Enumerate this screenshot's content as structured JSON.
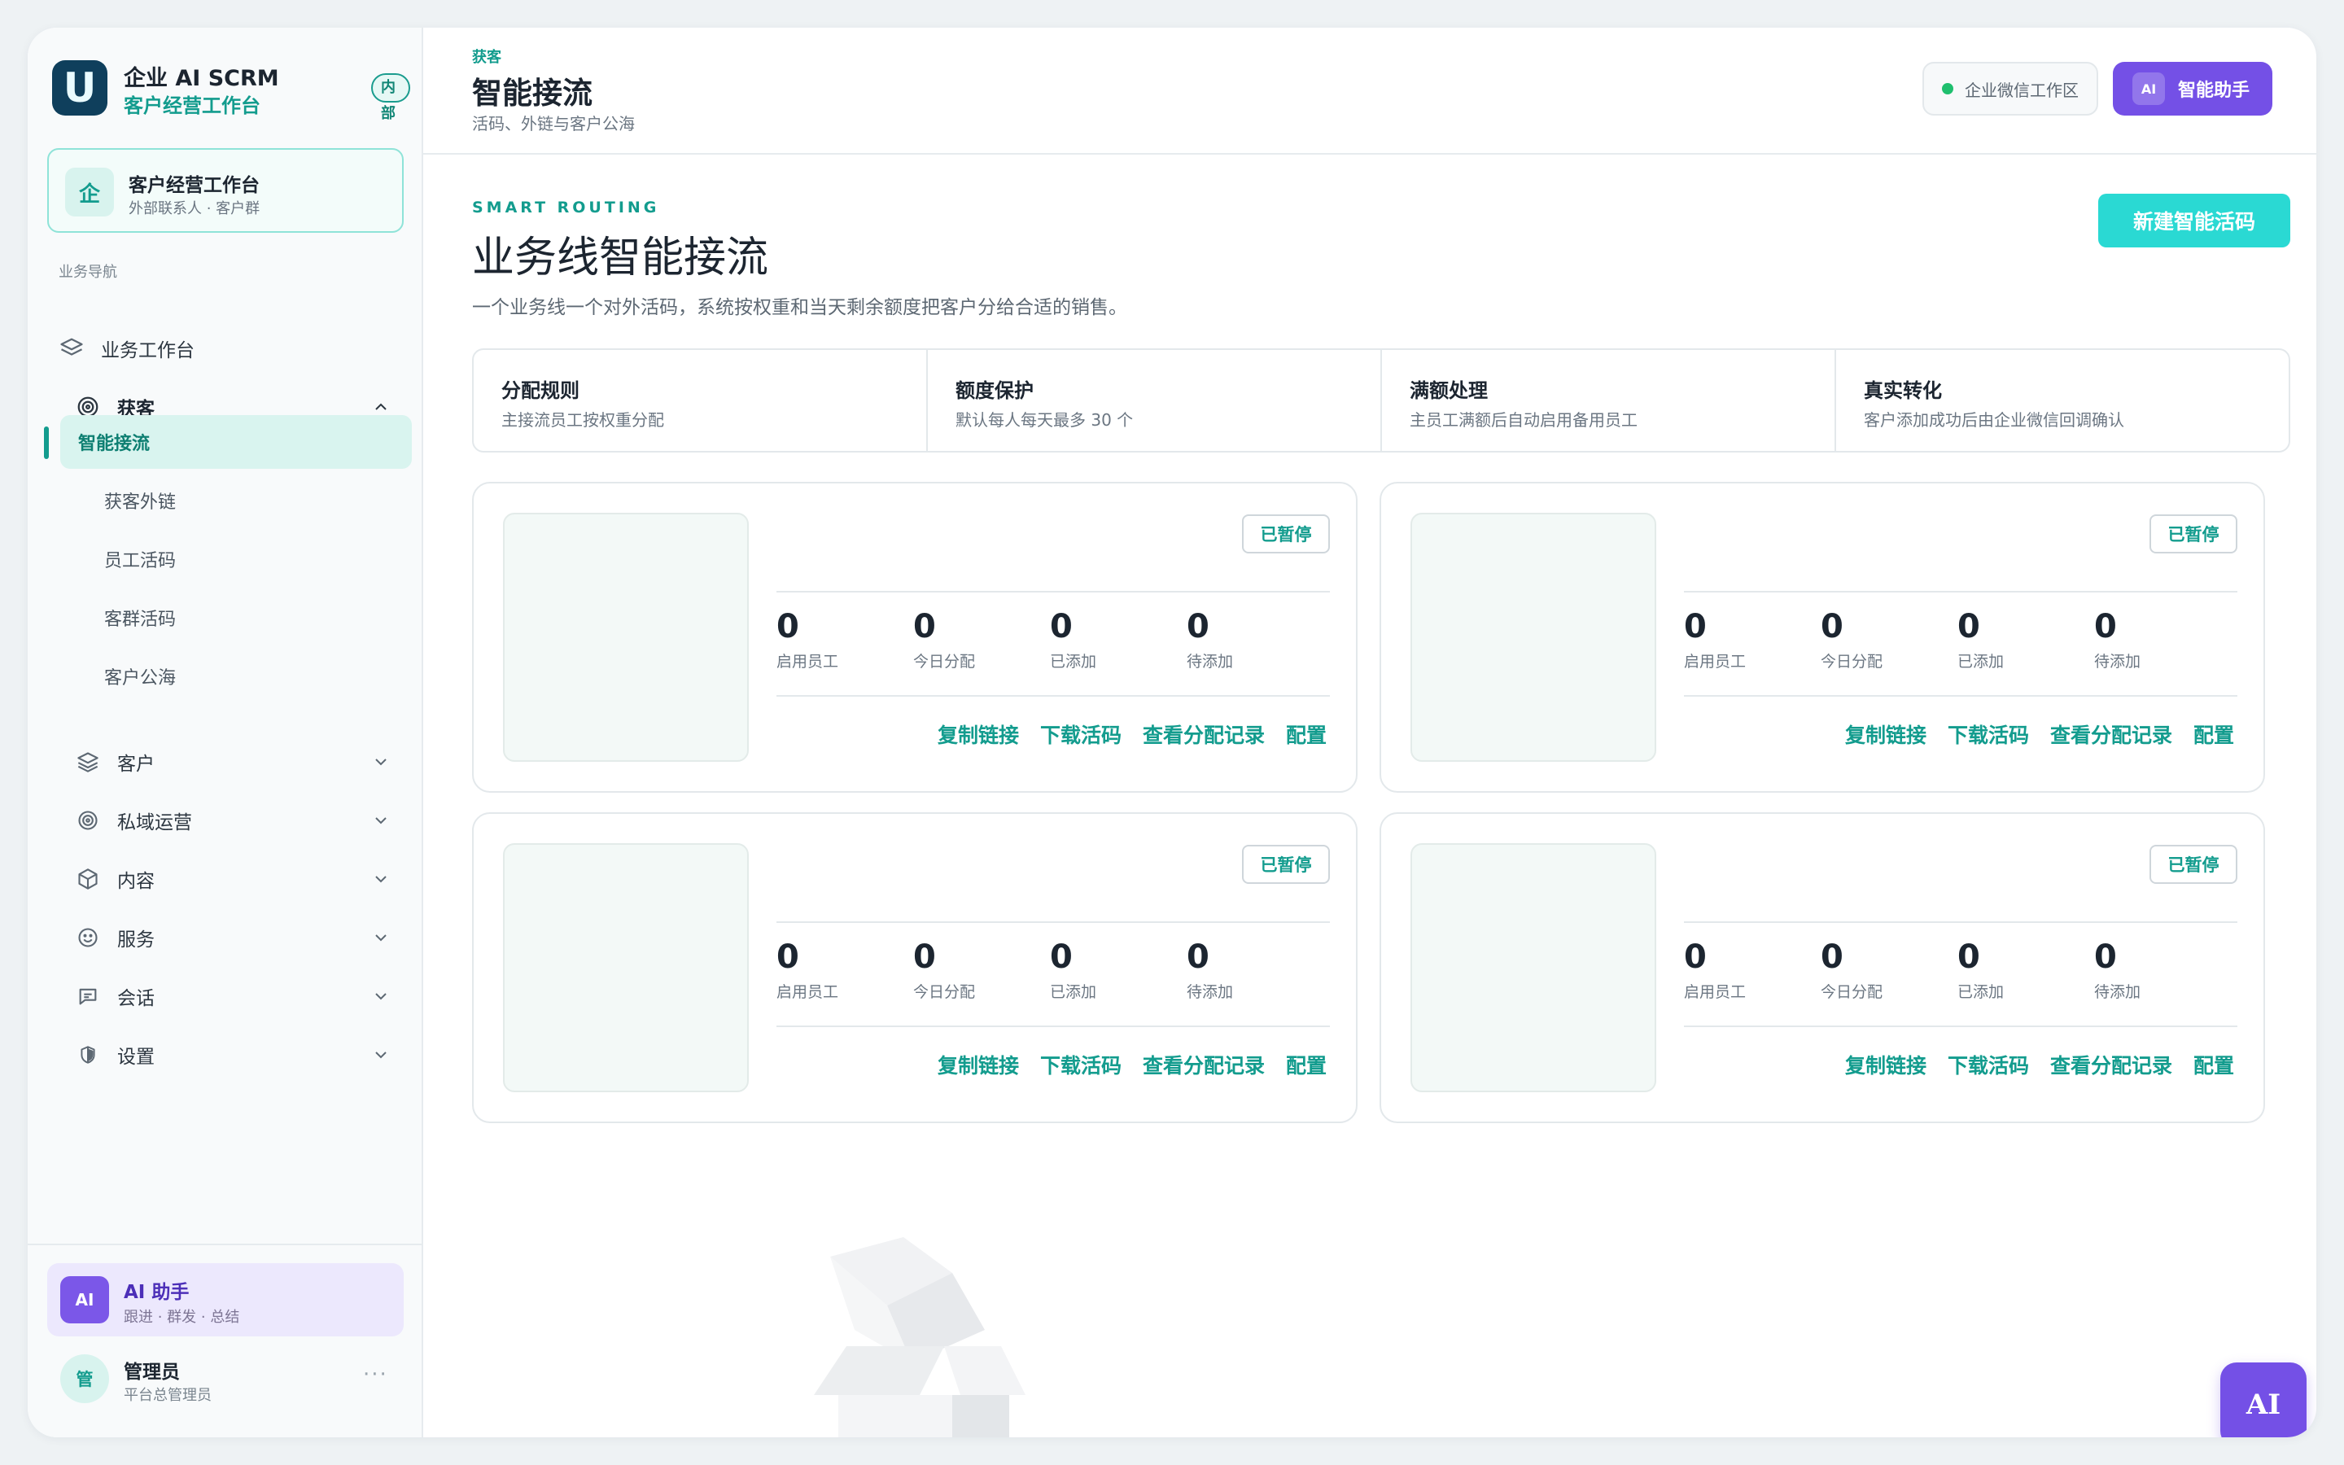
{
  "brand": {
    "logo": "U",
    "name": "企业 AI SCRM",
    "subtitle": "客户经营工作台",
    "badge": "内部"
  },
  "workspace": {
    "icon": "企",
    "title": "客户经营工作台",
    "subtitle": "外部联系人 · 客户群"
  },
  "nav": {
    "section_label": "业务导航",
    "workbench": "业务工作台",
    "acquisition": {
      "label": "获客",
      "children": [
        "智能接流",
        "获客外链",
        "员工活码",
        "客群活码",
        "客户公海"
      ],
      "active": "智能接流"
    },
    "groups": [
      "客户",
      "私域运营",
      "内容",
      "服务",
      "会话",
      "设置"
    ]
  },
  "sidebar_footer": {
    "ai_badge": "AI",
    "ai_title": "AI 助手",
    "ai_subtitle": "跟进 · 群发 · 总结",
    "user_avatar": "管",
    "user_name": "管理员",
    "user_role": "平台总管理员",
    "more": "···"
  },
  "header": {
    "breadcrumb": "获客",
    "title": "智能接流",
    "subtitle": "活码、外链与客户公海",
    "workspace_pill": "企业微信工作区",
    "assistant_badge": "AI",
    "assistant_label": "智能助手",
    "status_color": "#1fbf6e"
  },
  "hero": {
    "eyebrow": "SMART ROUTING",
    "title": "业务线智能接流",
    "description": "一个业务线一个对外活码，系统按权重和当天剩余额度把客户分给合适的销售。",
    "new_button": "新建智能活码"
  },
  "features": [
    {
      "title": "分配规则",
      "desc": "主接流员工按权重分配"
    },
    {
      "title": "额度保护",
      "desc": "默认每人每天最多 30 个"
    },
    {
      "title": "满额处理",
      "desc": "主员工满额后自动启用备用员工"
    },
    {
      "title": "真实转化",
      "desc": "客户添加成功后由企业微信回调确认"
    }
  ],
  "cards": [
    {
      "status": "已暂停",
      "stats": [
        {
          "value": "0",
          "label": "启用员工"
        },
        {
          "value": "0",
          "label": "今日分配"
        },
        {
          "value": "0",
          "label": "已添加"
        },
        {
          "value": "0",
          "label": "待添加"
        }
      ]
    },
    {
      "status": "已暂停",
      "stats": [
        {
          "value": "0",
          "label": "启用员工"
        },
        {
          "value": "0",
          "label": "今日分配"
        },
        {
          "value": "0",
          "label": "已添加"
        },
        {
          "value": "0",
          "label": "待添加"
        }
      ]
    },
    {
      "status": "已暂停",
      "stats": [
        {
          "value": "0",
          "label": "启用员工"
        },
        {
          "value": "0",
          "label": "今日分配"
        },
        {
          "value": "0",
          "label": "已添加"
        },
        {
          "value": "0",
          "label": "待添加"
        }
      ]
    },
    {
      "status": "已暂停",
      "stats": [
        {
          "value": "0",
          "label": "启用员工"
        },
        {
          "value": "0",
          "label": "今日分配"
        },
        {
          "value": "0",
          "label": "已添加"
        },
        {
          "value": "0",
          "label": "待添加"
        }
      ]
    }
  ],
  "card_actions": {
    "copy": "复制链接",
    "download": "下载活码",
    "records": "查看分配记录",
    "config": "配置"
  },
  "fab": "AI",
  "colors": {
    "accent": "#139c8e",
    "primary_purple": "#7450e6",
    "cta_cyan": "#2ad9d3"
  }
}
